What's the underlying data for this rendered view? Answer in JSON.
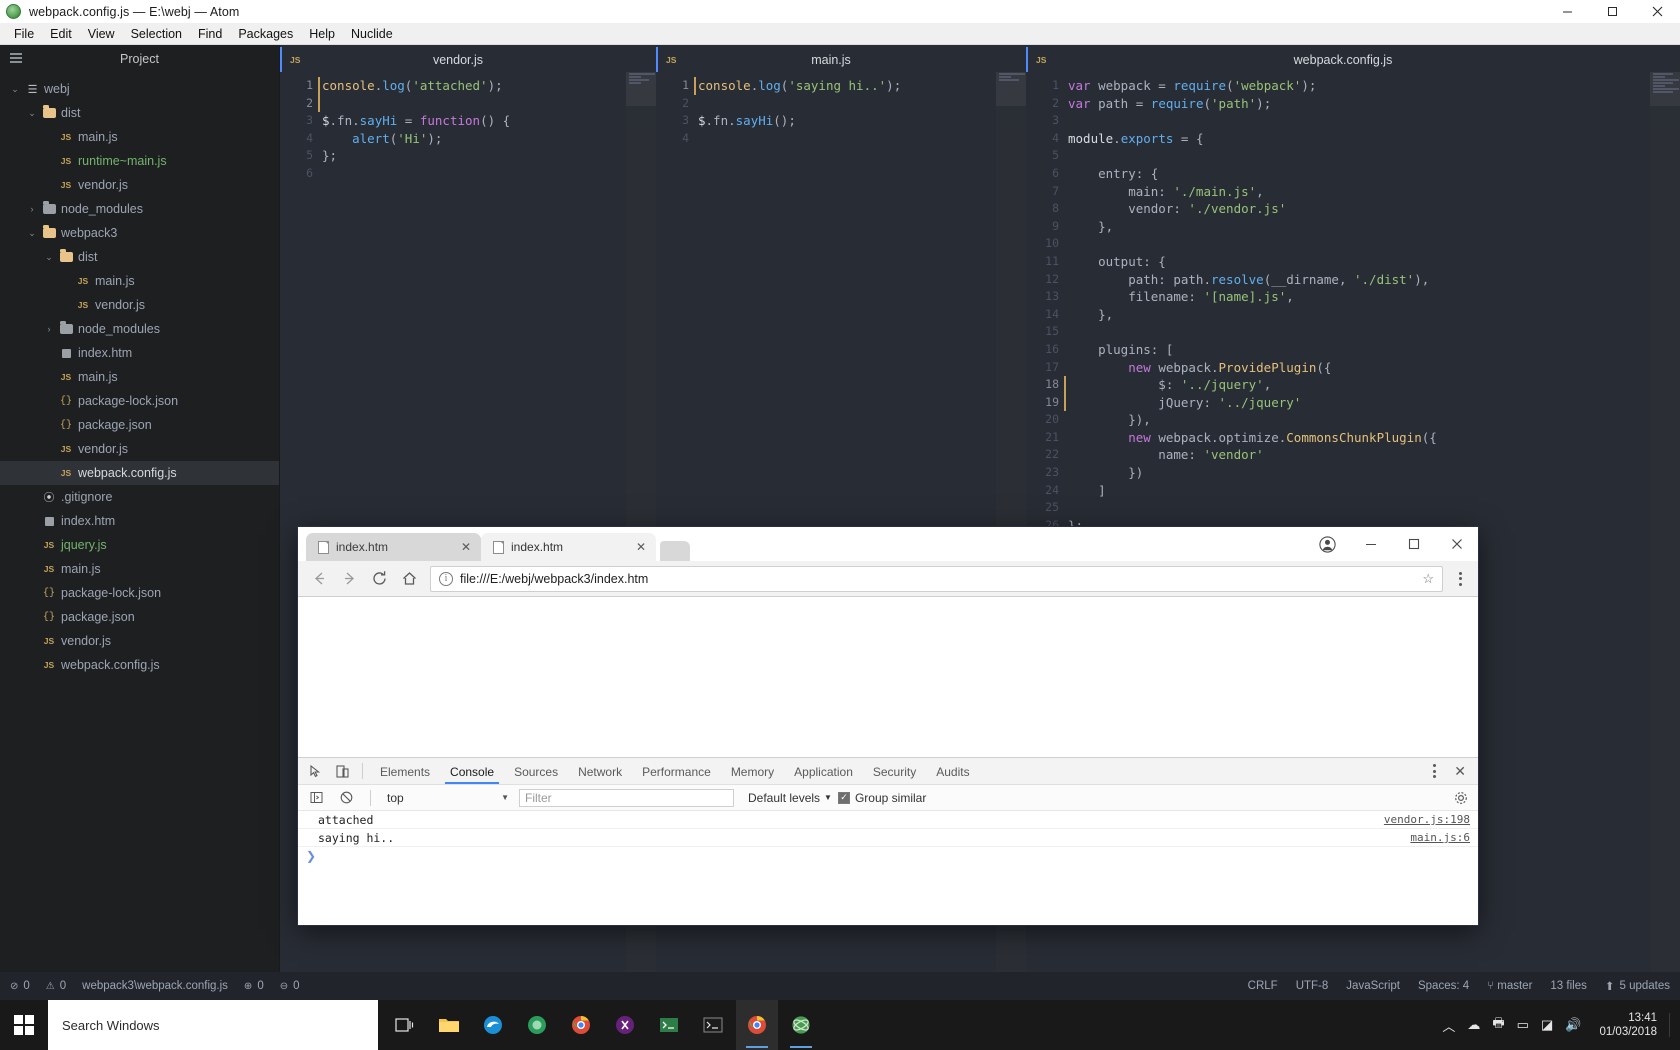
{
  "atom": {
    "title": "webpack.config.js — E:\\webj — Atom",
    "logo_icon": "atom-logo-icon",
    "menu": [
      "File",
      "Edit",
      "View",
      "Selection",
      "Find",
      "Packages",
      "Help",
      "Nuclide"
    ],
    "window_controls": {
      "minimize": "minimize-icon",
      "maximize": "maximize-icon",
      "close": "close-icon"
    },
    "tree": {
      "title": "Project",
      "items": [
        {
          "label": "webj",
          "indent": 0,
          "type": "root",
          "twisty": "down",
          "color": "normal",
          "selected": false
        },
        {
          "label": "dist",
          "indent": 1,
          "type": "folder",
          "twisty": "down",
          "color": "normal",
          "selected": false
        },
        {
          "label": "main.js",
          "indent": 2,
          "type": "js",
          "twisty": "",
          "color": "normal",
          "selected": false
        },
        {
          "label": "runtime~main.js",
          "indent": 2,
          "type": "js",
          "twisty": "",
          "color": "green",
          "selected": false
        },
        {
          "label": "vendor.js",
          "indent": 2,
          "type": "js",
          "twisty": "",
          "color": "normal",
          "selected": false
        },
        {
          "label": "node_modules",
          "indent": 1,
          "type": "folder-grey",
          "twisty": "right",
          "color": "normal",
          "selected": false
        },
        {
          "label": "webpack3",
          "indent": 1,
          "type": "folder",
          "twisty": "down",
          "color": "normal",
          "selected": false
        },
        {
          "label": "dist",
          "indent": 2,
          "type": "folder",
          "twisty": "down",
          "color": "normal",
          "selected": false
        },
        {
          "label": "main.js",
          "indent": 3,
          "type": "js",
          "twisty": "",
          "color": "normal",
          "selected": false
        },
        {
          "label": "vendor.js",
          "indent": 3,
          "type": "js",
          "twisty": "",
          "color": "normal",
          "selected": false
        },
        {
          "label": "node_modules",
          "indent": 2,
          "type": "folder-grey",
          "twisty": "right",
          "color": "normal",
          "selected": false
        },
        {
          "label": "index.htm",
          "indent": 2,
          "type": "html",
          "twisty": "",
          "color": "normal",
          "selected": false
        },
        {
          "label": "main.js",
          "indent": 2,
          "type": "js",
          "twisty": "",
          "color": "normal",
          "selected": false
        },
        {
          "label": "package-lock.json",
          "indent": 2,
          "type": "json",
          "twisty": "",
          "color": "normal",
          "selected": false
        },
        {
          "label": "package.json",
          "indent": 2,
          "type": "json",
          "twisty": "",
          "color": "normal",
          "selected": false
        },
        {
          "label": "vendor.js",
          "indent": 2,
          "type": "js",
          "twisty": "",
          "color": "normal",
          "selected": false
        },
        {
          "label": "webpack.config.js",
          "indent": 2,
          "type": "js",
          "twisty": "",
          "color": "sel",
          "selected": true
        },
        {
          "label": ".gitignore",
          "indent": 1,
          "type": "git",
          "twisty": "",
          "color": "normal",
          "selected": false
        },
        {
          "label": "index.htm",
          "indent": 1,
          "type": "html",
          "twisty": "",
          "color": "normal",
          "selected": false
        },
        {
          "label": "jquery.js",
          "indent": 1,
          "type": "js",
          "twisty": "",
          "color": "green",
          "selected": false
        },
        {
          "label": "main.js",
          "indent": 1,
          "type": "js",
          "twisty": "",
          "color": "normal",
          "selected": false
        },
        {
          "label": "package-lock.json",
          "indent": 1,
          "type": "json",
          "twisty": "",
          "color": "normal",
          "selected": false
        },
        {
          "label": "package.json",
          "indent": 1,
          "type": "json",
          "twisty": "",
          "color": "normal",
          "selected": false
        },
        {
          "label": "vendor.js",
          "indent": 1,
          "type": "js",
          "twisty": "",
          "color": "normal",
          "selected": false
        },
        {
          "label": "webpack.config.js",
          "indent": 1,
          "type": "js",
          "twisty": "",
          "color": "normal",
          "selected": false
        }
      ]
    },
    "panes": [
      {
        "tab_label": "vendor.js",
        "tab_icon": "js-file-icon",
        "line_count": 6,
        "cursor_lines": [
          1,
          2
        ],
        "lines": [
          [
            {
              "t": "console",
              "c": "t-var"
            },
            {
              "t": ".",
              "c": "t-plain"
            },
            {
              "t": "log",
              "c": "t-fn"
            },
            {
              "t": "(",
              "c": "t-plain"
            },
            {
              "t": "'attached'",
              "c": "t-str"
            },
            {
              "t": ");",
              "c": "t-plain"
            }
          ],
          [],
          [
            {
              "t": "$",
              "c": "t-white"
            },
            {
              "t": ".fn.",
              "c": "t-plain"
            },
            {
              "t": "sayHi",
              "c": "t-fn"
            },
            {
              "t": " = ",
              "c": "t-plain"
            },
            {
              "t": "function",
              "c": "t-key"
            },
            {
              "t": "() {",
              "c": "t-plain"
            }
          ],
          [
            {
              "t": "    ",
              "c": "t-plain"
            },
            {
              "t": "alert",
              "c": "t-fn"
            },
            {
              "t": "(",
              "c": "t-plain"
            },
            {
              "t": "'Hi'",
              "c": "t-str"
            },
            {
              "t": ");",
              "c": "t-plain"
            }
          ],
          [
            {
              "t": "};",
              "c": "t-plain"
            }
          ],
          []
        ]
      },
      {
        "tab_label": "main.js",
        "tab_icon": "js-file-icon",
        "line_count": 4,
        "cursor_lines": [
          1
        ],
        "lines": [
          [
            {
              "t": "console",
              "c": "t-var"
            },
            {
              "t": ".",
              "c": "t-plain"
            },
            {
              "t": "log",
              "c": "t-fn"
            },
            {
              "t": "(",
              "c": "t-plain"
            },
            {
              "t": "'saying hi..'",
              "c": "t-str"
            },
            {
              "t": ");",
              "c": "t-plain"
            }
          ],
          [],
          [
            {
              "t": "$",
              "c": "t-white"
            },
            {
              "t": ".fn.",
              "c": "t-plain"
            },
            {
              "t": "sayHi",
              "c": "t-fn"
            },
            {
              "t": "();",
              "c": "t-plain"
            }
          ],
          []
        ]
      },
      {
        "tab_label": "webpack.config.js",
        "tab_icon": "js-file-icon",
        "line_count": 26,
        "cursor_lines": [
          18,
          19
        ],
        "lines": [
          [
            {
              "t": "var",
              "c": "t-key"
            },
            {
              "t": " webpack = ",
              "c": "t-plain"
            },
            {
              "t": "require",
              "c": "t-fn"
            },
            {
              "t": "(",
              "c": "t-plain"
            },
            {
              "t": "'webpack'",
              "c": "t-str"
            },
            {
              "t": ");",
              "c": "t-plain"
            }
          ],
          [
            {
              "t": "var",
              "c": "t-key"
            },
            {
              "t": " path = ",
              "c": "t-plain"
            },
            {
              "t": "require",
              "c": "t-fn"
            },
            {
              "t": "(",
              "c": "t-plain"
            },
            {
              "t": "'path'",
              "c": "t-str"
            },
            {
              "t": ");",
              "c": "t-plain"
            }
          ],
          [],
          [
            {
              "t": "module",
              "c": "t-white"
            },
            {
              "t": ".",
              "c": "t-plain"
            },
            {
              "t": "exports",
              "c": "t-fn"
            },
            {
              "t": " = {",
              "c": "t-plain"
            }
          ],
          [],
          [
            {
              "t": "    entry: {",
              "c": "t-plain"
            }
          ],
          [
            {
              "t": "        main: ",
              "c": "t-plain"
            },
            {
              "t": "'./main.js'",
              "c": "t-str"
            },
            {
              "t": ",",
              "c": "t-plain"
            }
          ],
          [
            {
              "t": "        vendor: ",
              "c": "t-plain"
            },
            {
              "t": "'./vendor.js'",
              "c": "t-str"
            }
          ],
          [
            {
              "t": "    },",
              "c": "t-plain"
            }
          ],
          [],
          [
            {
              "t": "    output: {",
              "c": "t-plain"
            }
          ],
          [
            {
              "t": "        path: path.",
              "c": "t-plain"
            },
            {
              "t": "resolve",
              "c": "t-fn"
            },
            {
              "t": "(__dirname, ",
              "c": "t-plain"
            },
            {
              "t": "'./dist'",
              "c": "t-str"
            },
            {
              "t": "),",
              "c": "t-plain"
            }
          ],
          [
            {
              "t": "        filename: ",
              "c": "t-plain"
            },
            {
              "t": "'[name].js'",
              "c": "t-str"
            },
            {
              "t": ",",
              "c": "t-plain"
            }
          ],
          [
            {
              "t": "    },",
              "c": "t-plain"
            }
          ],
          [],
          [
            {
              "t": "    plugins: [",
              "c": "t-plain"
            }
          ],
          [
            {
              "t": "        ",
              "c": "t-plain"
            },
            {
              "t": "new",
              "c": "t-key"
            },
            {
              "t": " webpack.",
              "c": "t-plain"
            },
            {
              "t": "ProvidePlugin",
              "c": "t-var"
            },
            {
              "t": "({",
              "c": "t-plain"
            }
          ],
          [
            {
              "t": "            $: ",
              "c": "t-plain"
            },
            {
              "t": "'../jquery'",
              "c": "t-str"
            },
            {
              "t": ",",
              "c": "t-plain"
            }
          ],
          [
            {
              "t": "            jQuery: ",
              "c": "t-plain"
            },
            {
              "t": "'../jquery'",
              "c": "t-str"
            }
          ],
          [
            {
              "t": "        }),",
              "c": "t-plain"
            }
          ],
          [
            {
              "t": "        ",
              "c": "t-plain"
            },
            {
              "t": "new",
              "c": "t-key"
            },
            {
              "t": " webpack.optimize.",
              "c": "t-plain"
            },
            {
              "t": "CommonsChunkPlugin",
              "c": "t-var"
            },
            {
              "t": "({",
              "c": "t-plain"
            }
          ],
          [
            {
              "t": "            name: ",
              "c": "t-plain"
            },
            {
              "t": "'vendor'",
              "c": "t-str"
            }
          ],
          [
            {
              "t": "        })",
              "c": "t-plain"
            }
          ],
          [
            {
              "t": "    ]",
              "c": "t-plain"
            }
          ],
          [],
          [
            {
              "t": "};",
              "c": "t-plain"
            }
          ]
        ]
      }
    ],
    "status": {
      "error_count": "0",
      "warning_count": "0",
      "file_path": "webpack3\\webpack.config.js",
      "git_added": "0",
      "git_removed": "0",
      "line_ending": "CRLF",
      "encoding": "UTF-8",
      "grammar": "JavaScript",
      "indent": "Spaces: 4",
      "branch": "master",
      "files_changed": "13 files",
      "updates": "5 updates"
    }
  },
  "chrome": {
    "tabs": [
      {
        "label": "index.htm",
        "active": false,
        "close_icon": "close-icon"
      },
      {
        "label": "index.htm",
        "active": true,
        "close_icon": "close-icon"
      }
    ],
    "new_tab_icon": "new-tab-icon",
    "window_controls": {
      "profile": "profile-icon",
      "minimize": "minimize-icon",
      "maximize": "maximize-icon",
      "close": "close-icon"
    },
    "toolbar": {
      "back_icon": "back-arrow-icon",
      "forward_icon": "forward-arrow-icon",
      "reload_icon": "reload-icon",
      "home_icon": "home-icon",
      "info_icon": "page-info-icon",
      "url": "file:///E:/webj/webpack3/index.htm",
      "star_icon": "bookmark-star-icon",
      "menu_icon": "chrome-menu-icon"
    },
    "devtools": {
      "inspect_icon": "inspect-element-icon",
      "device_icon": "device-toolbar-icon",
      "tabs": [
        "Elements",
        "Console",
        "Sources",
        "Network",
        "Performance",
        "Memory",
        "Application",
        "Security",
        "Audits"
      ],
      "active_tab": "Console",
      "more_icon": "more-options-icon",
      "close_icon": "close-devtools-icon",
      "console": {
        "sidebar_icon": "console-sidebar-icon",
        "clear_icon": "clear-console-icon",
        "context": "top",
        "context_caret": "chevron-down-icon",
        "filter_placeholder": "Filter",
        "levels_label": "Default levels",
        "levels_caret": "chevron-down-icon",
        "group_similar_label": "Group similar",
        "group_similar_checked": true,
        "settings_icon": "gear-icon",
        "messages": [
          {
            "text": "attached",
            "source": "vendor.js:198"
          },
          {
            "text": "saying hi..",
            "source": "main.js:6"
          }
        ],
        "prompt_icon": "console-prompt-arrow"
      }
    }
  },
  "taskbar": {
    "start_icon": "windows-start-icon",
    "search_placeholder": "Search Windows",
    "task_view_icon": "task-view-icon",
    "apps": [
      {
        "name": "file-explorer-icon",
        "running": false,
        "active": false
      },
      {
        "name": "edge-icon",
        "running": false,
        "active": false
      },
      {
        "name": "firefox-icon",
        "running": false,
        "active": false
      },
      {
        "name": "chrome-icon",
        "running": false,
        "active": false
      },
      {
        "name": "vs-icon",
        "running": false,
        "active": false
      },
      {
        "name": "terminal-icon",
        "running": false,
        "active": false
      },
      {
        "name": "cmd-icon",
        "running": false,
        "active": false
      },
      {
        "name": "chrome-window-icon",
        "running": true,
        "active": true
      },
      {
        "name": "atom-icon",
        "running": true,
        "active": false
      }
    ],
    "tray": {
      "onedrive_icon": "onedrive-icon",
      "printer_icon": "printer-icon",
      "battery_icon": "battery-icon",
      "network_icon": "network-icon",
      "volume_icon": "volume-icon",
      "time": "13:41",
      "date": "01/03/2018"
    }
  }
}
